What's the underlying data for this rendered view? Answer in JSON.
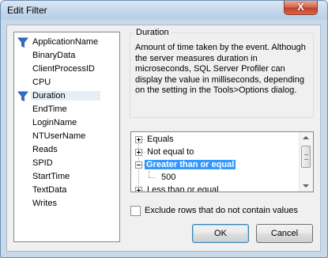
{
  "window": {
    "title": "Edit Filter",
    "close_label": "X"
  },
  "columns": {
    "items": [
      {
        "label": "ApplicationName",
        "filtered": true,
        "selected": false
      },
      {
        "label": "BinaryData",
        "filtered": false,
        "selected": false
      },
      {
        "label": "ClientProcessID",
        "filtered": false,
        "selected": false
      },
      {
        "label": "CPU",
        "filtered": false,
        "selected": false
      },
      {
        "label": "Duration",
        "filtered": true,
        "selected": true
      },
      {
        "label": "EndTime",
        "filtered": false,
        "selected": false
      },
      {
        "label": "LoginName",
        "filtered": false,
        "selected": false
      },
      {
        "label": "NTUserName",
        "filtered": false,
        "selected": false
      },
      {
        "label": "Reads",
        "filtered": false,
        "selected": false
      },
      {
        "label": "SPID",
        "filtered": false,
        "selected": false
      },
      {
        "label": "StartTime",
        "filtered": false,
        "selected": false
      },
      {
        "label": "TextData",
        "filtered": false,
        "selected": false
      },
      {
        "label": "Writes",
        "filtered": false,
        "selected": false
      }
    ]
  },
  "description": {
    "title": "Duration",
    "text": "Amount of time taken by the event. Although the server measures duration in microseconds, SQL Server Profiler can display the value in milliseconds, depending on the setting in the Tools>Options dialog."
  },
  "operators": {
    "equals": "Equals",
    "not_equal": "Not equal to",
    "greater_or_equal": "Greater than or equal",
    "value": "500",
    "less_or_equal": "Less than or equal"
  },
  "exclude": {
    "label": "Exclude rows that do not contain values",
    "checked": false
  },
  "buttons": {
    "ok": "OK",
    "cancel": "Cancel"
  },
  "colors": {
    "selection": "#3399ff",
    "funnel": "#2f6fd0",
    "close": "#c3402a"
  }
}
